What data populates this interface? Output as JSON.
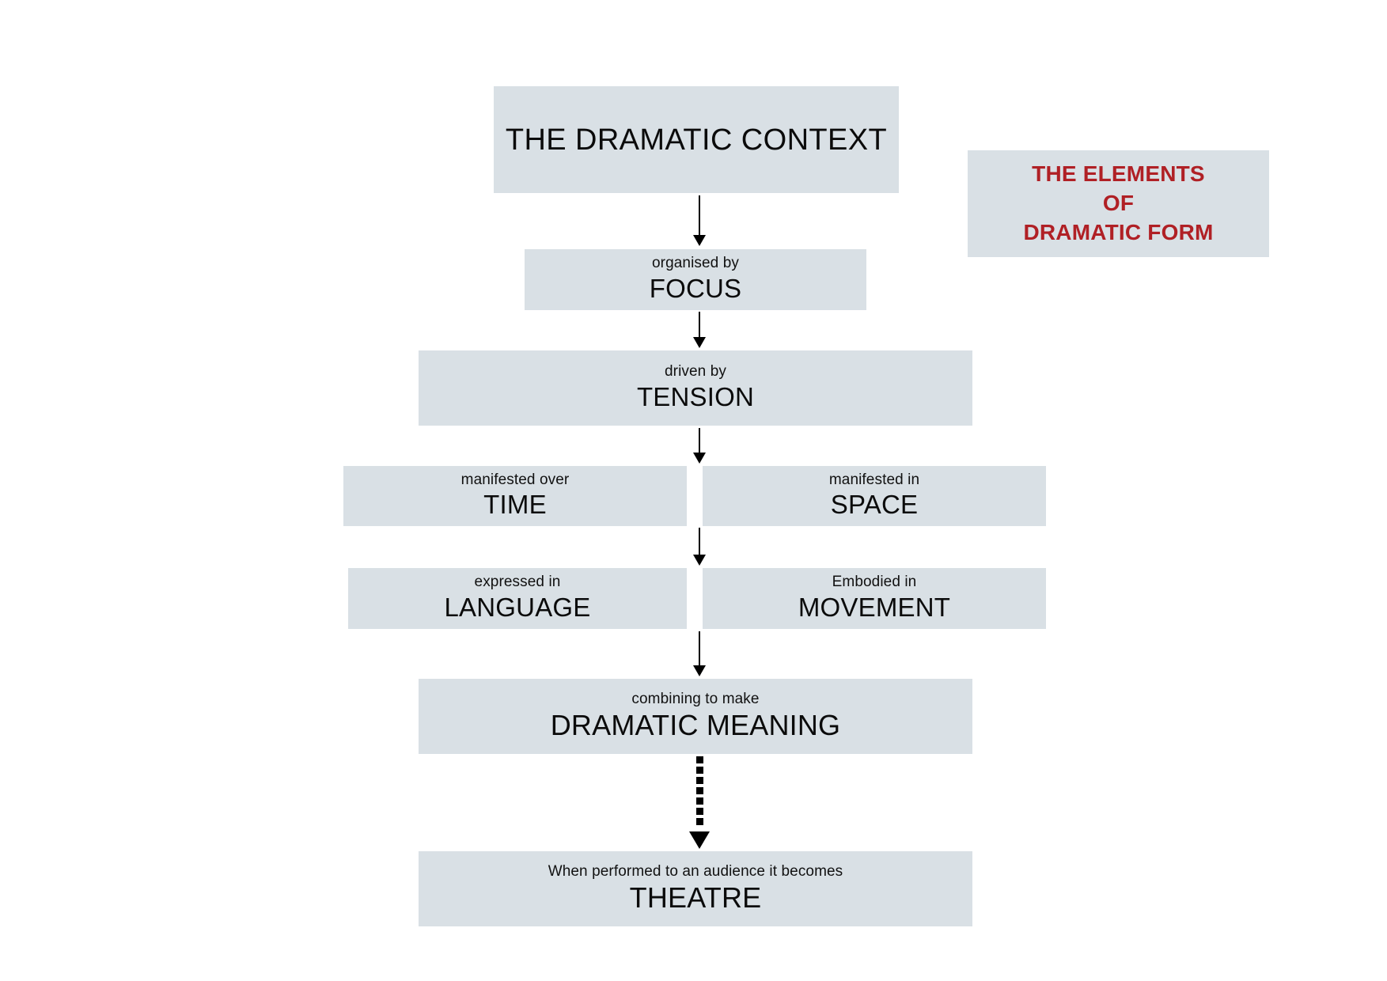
{
  "diagram": {
    "title_box": {
      "lines": [
        "THE ELEMENTS",
        "OF",
        "DRAMATIC FORM"
      ],
      "color": "#b02025"
    },
    "box_fill": "#d9e0e5",
    "nodes": [
      {
        "id": "context",
        "kicker": "",
        "term": "THE DRAMATIC CONTEXT"
      },
      {
        "id": "focus",
        "kicker": "organised by",
        "term": "FOCUS"
      },
      {
        "id": "tension",
        "kicker": "driven by",
        "term": "TENSION"
      },
      {
        "id": "time",
        "kicker": "manifested over",
        "term": "TIME"
      },
      {
        "id": "space",
        "kicker": "manifested in",
        "term": "SPACE"
      },
      {
        "id": "language",
        "kicker": "expressed in",
        "term": "LANGUAGE"
      },
      {
        "id": "movement",
        "kicker": "Embodied in",
        "term": "MOVEMENT"
      },
      {
        "id": "meaning",
        "kicker": "combining to make",
        "term": "DRAMATIC MEANING"
      },
      {
        "id": "theatre",
        "kicker": "When performed to an audience it becomes",
        "term": "THEATRE"
      }
    ],
    "connectors": [
      {
        "id": "context-to-focus",
        "style": "solid",
        "direction": "down"
      },
      {
        "id": "focus-to-tension",
        "style": "solid",
        "direction": "down"
      },
      {
        "id": "tension-to-time-space",
        "style": "solid",
        "direction": "down"
      },
      {
        "id": "time-space-to-language-movement",
        "style": "solid",
        "direction": "down"
      },
      {
        "id": "language-movement-to-meaning",
        "style": "solid",
        "direction": "down"
      },
      {
        "id": "meaning-to-theatre",
        "style": "dotted",
        "direction": "down"
      }
    ]
  }
}
